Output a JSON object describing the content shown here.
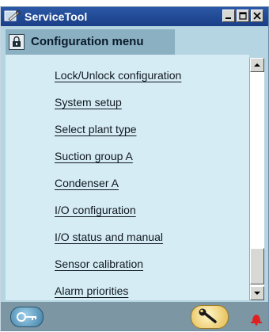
{
  "window": {
    "title": "ServiceTool",
    "controls": [
      "minimize",
      "maximize",
      "close"
    ]
  },
  "menu": {
    "title": "Configuration menu",
    "items": [
      {
        "label": "Lock/Unlock configuration"
      },
      {
        "label": "System setup"
      },
      {
        "label": "Select plant type"
      },
      {
        "label": "Suction group A"
      },
      {
        "label": "Condenser A"
      },
      {
        "label": "I/O configuration"
      },
      {
        "label": "I/O status and manual"
      },
      {
        "label": "Sensor calibration"
      },
      {
        "label": "Alarm priorities"
      }
    ]
  },
  "icons": {
    "app": "service-tool-icon",
    "menu_header": "padlock-icon",
    "status_left": "key-icon",
    "status_middle": "wrench-icon",
    "status_right": "alarm-bell-icon"
  },
  "colors": {
    "titlebar": "#1f4a96",
    "menu_header": "#8ab0c1",
    "content_background": "#d6ecf5",
    "statusbar": "#7c96a4",
    "alarm": "#e02020"
  }
}
